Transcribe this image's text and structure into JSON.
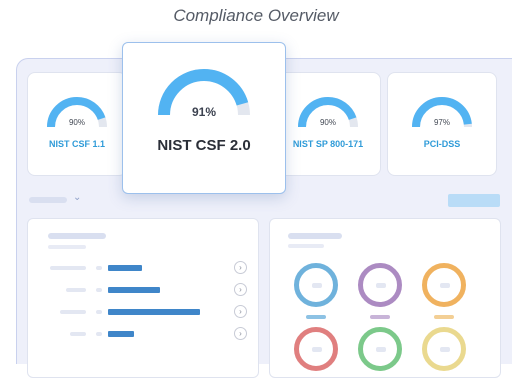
{
  "title": "Compliance Overview",
  "frameworks": [
    {
      "name": "NIST CSF 1.1",
      "value_label": "90%",
      "value": 90
    },
    {
      "name": "NIST CSF 2.0",
      "value_label": "91%",
      "value": 91
    },
    {
      "name": "NIST SP 800-171",
      "value_label": "90%",
      "value": 90
    },
    {
      "name": "PCI-DSS",
      "value_label": "97%",
      "value": 97
    }
  ],
  "colors": {
    "gauge_fill": "#52b3f2",
    "gauge_track": "#e3e7ef",
    "accent": "#2f9bd8",
    "bar": "#3f86c9",
    "button": "#b9dcf7"
  },
  "filter_dropdown": {
    "icon": "chevron-down-icon"
  },
  "list_panel": {
    "rows": [
      {
        "value": 0.34
      },
      {
        "value": 0.52
      },
      {
        "value": 0.92
      },
      {
        "value": 0.26
      }
    ],
    "row_icon": "arrow-right-icon"
  },
  "donut_panel": {
    "colors": [
      "#6fb2dc",
      "#ac8bc2",
      "#f0b25f",
      "#e07f7f",
      "#7cc98a",
      "#ead98f"
    ]
  }
}
